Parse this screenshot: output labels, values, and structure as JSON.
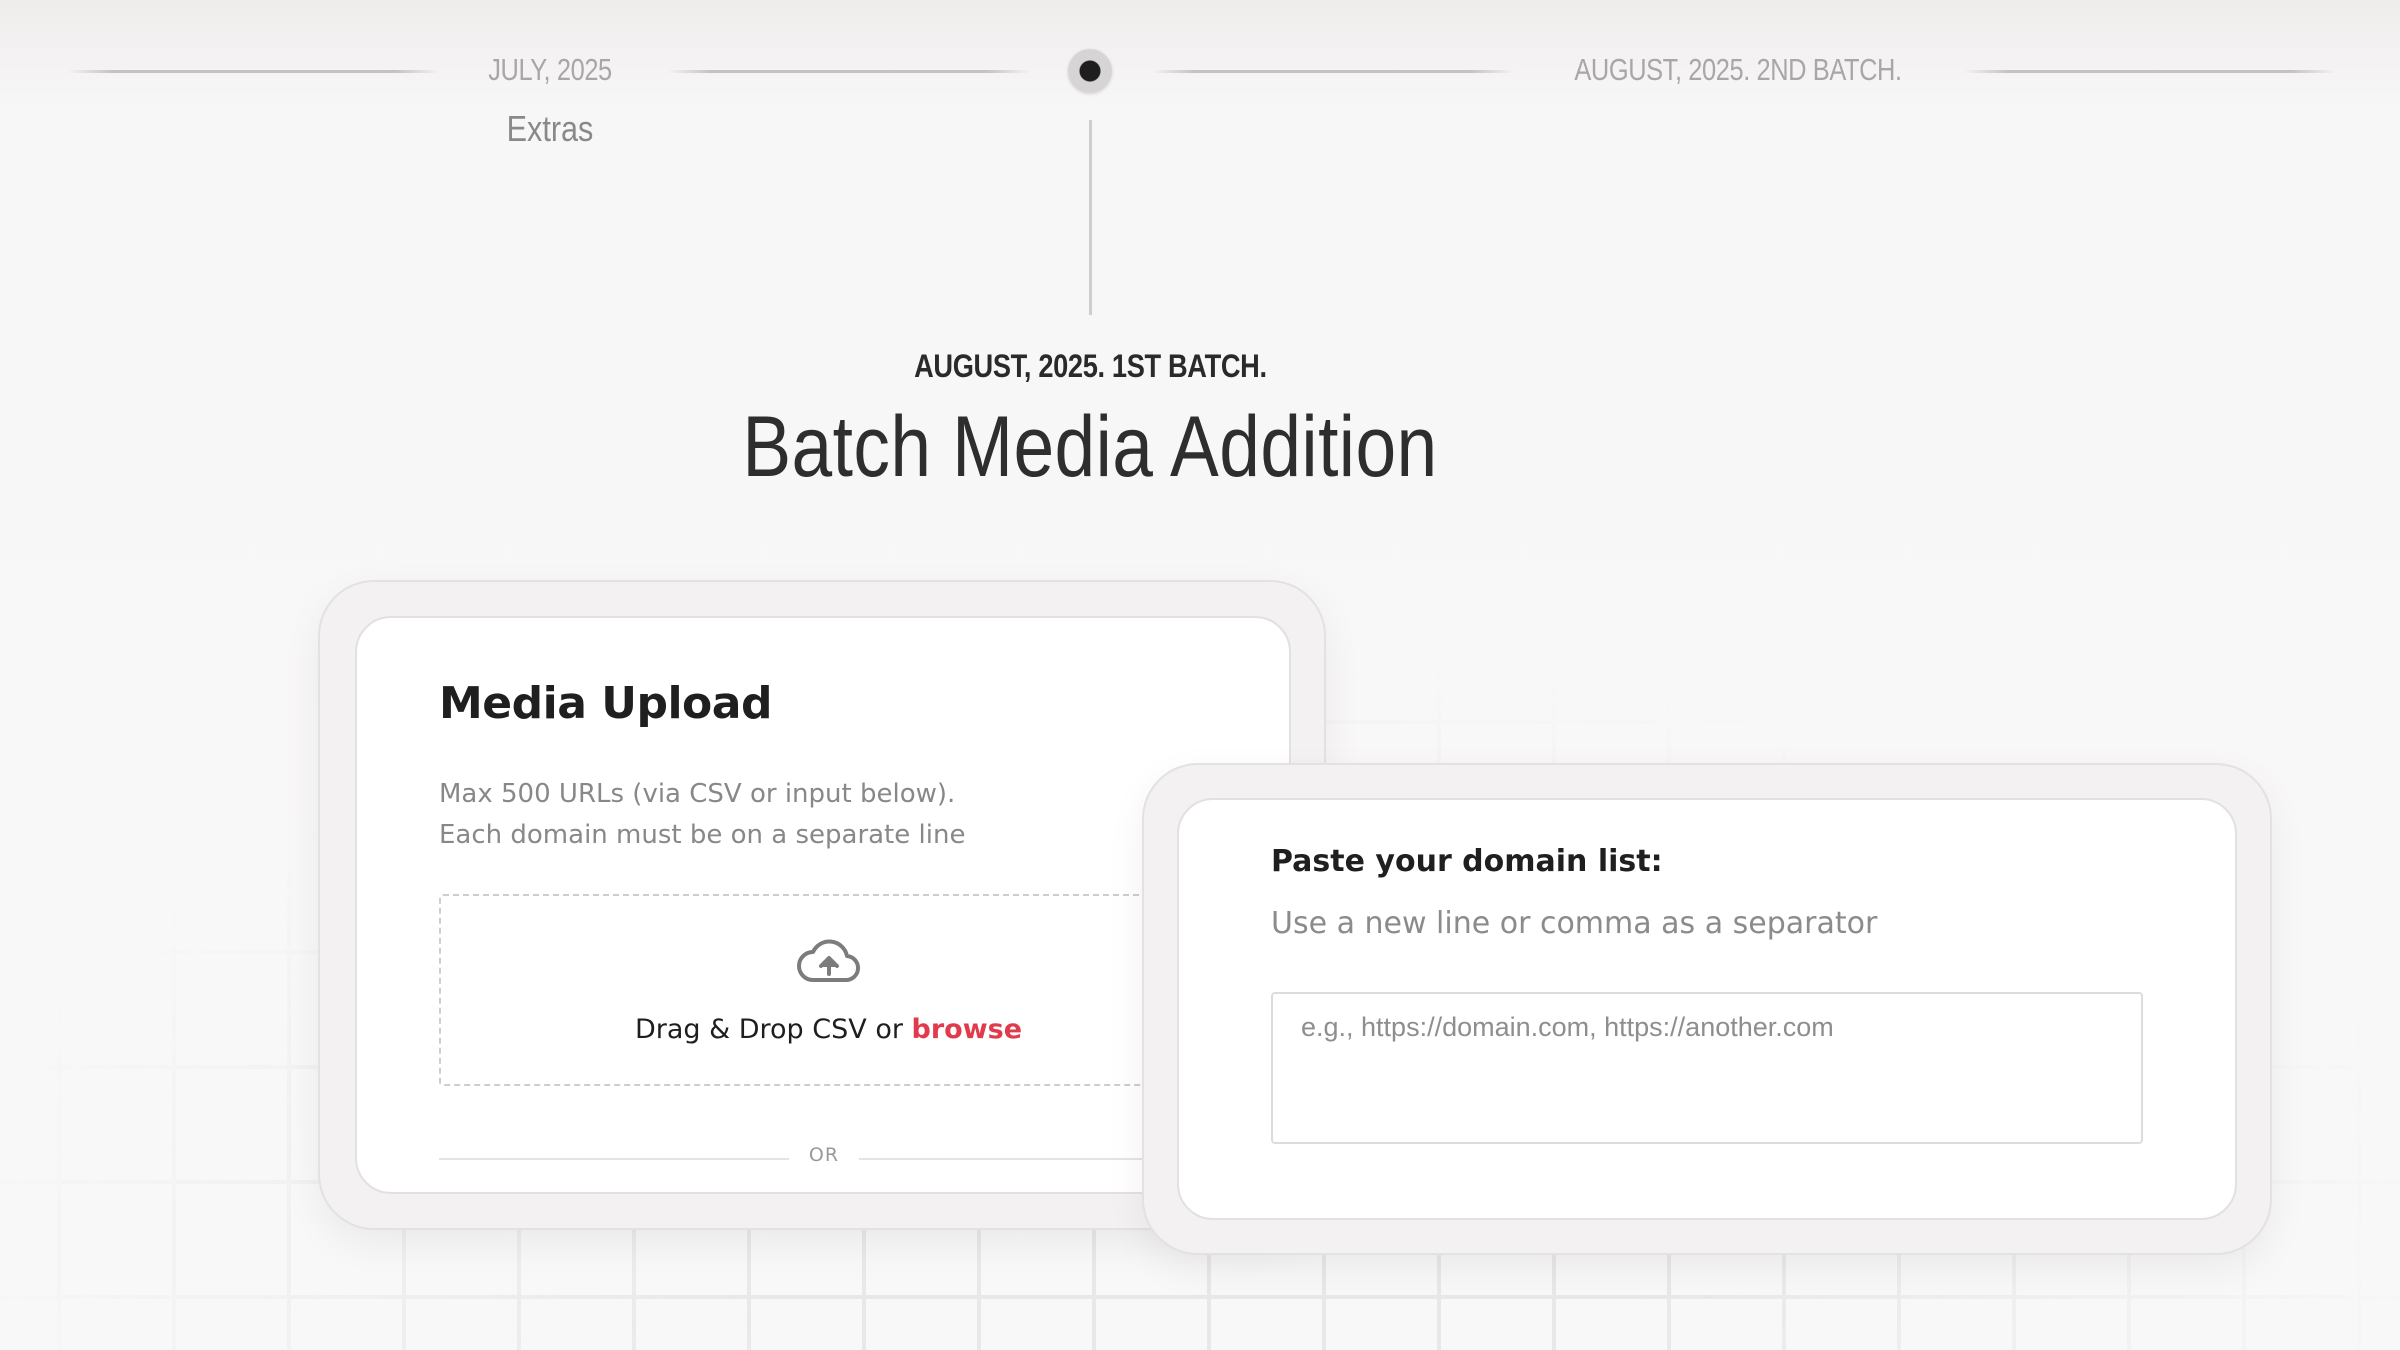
{
  "timeline": {
    "previous": {
      "label": "JULY, 2025",
      "sub": "Extras"
    },
    "next": {
      "label": "AUGUST, 2025. 2ND BATCH."
    },
    "current": {
      "label": "AUGUST, 2025. 1ST BATCH."
    }
  },
  "main": {
    "title": "Batch Media Addition"
  },
  "upload_card": {
    "title": "Media Upload",
    "desc_line1": "Max 500 URLs (via CSV or input below).",
    "desc_line2": "Each domain must be on a separate line",
    "icon": "cloud-upload-icon",
    "drop_text": "Drag & Drop CSV or",
    "browse_label": "browse",
    "or_label": "OR"
  },
  "paste_card": {
    "title": "Paste your domain list:",
    "subtitle": "Use a new line or comma as a separator",
    "textarea_value": "",
    "textarea_placeholder": "e.g., https://domain.com, https://another.com"
  },
  "colors": {
    "accent": "#e23a4d",
    "text_dark": "#1f1f1f",
    "text_muted": "#8a8787"
  }
}
